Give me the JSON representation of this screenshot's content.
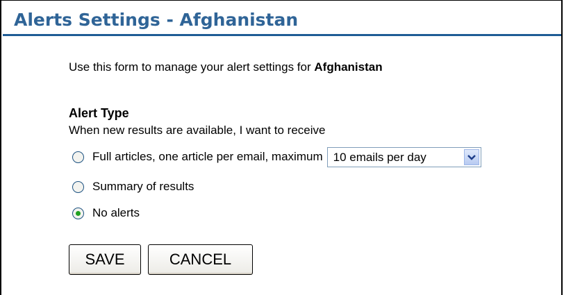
{
  "header": {
    "title": "Alerts Settings - Afghanistan"
  },
  "form": {
    "intro_prefix": "Use this form to manage your alert settings for ",
    "intro_country": "Afghanistan",
    "alert_type": {
      "title": "Alert Type",
      "subtitle": "When new results are available, I want to receive",
      "options": [
        {
          "label": "Full articles, one article per email, maximum",
          "checked": false
        },
        {
          "label": "Summary of results",
          "checked": false
        },
        {
          "label": "No alerts",
          "checked": true
        }
      ],
      "frequency_select": {
        "selected": "10 emails per day"
      }
    },
    "buttons": {
      "save": "SAVE",
      "cancel": "CANCEL"
    }
  },
  "colors": {
    "header_text": "#2f6497",
    "header_rule": "#1f5c95",
    "radio_selected": "#21a121"
  },
  "icons": {
    "select_arrow": "chevron-down-icon"
  }
}
